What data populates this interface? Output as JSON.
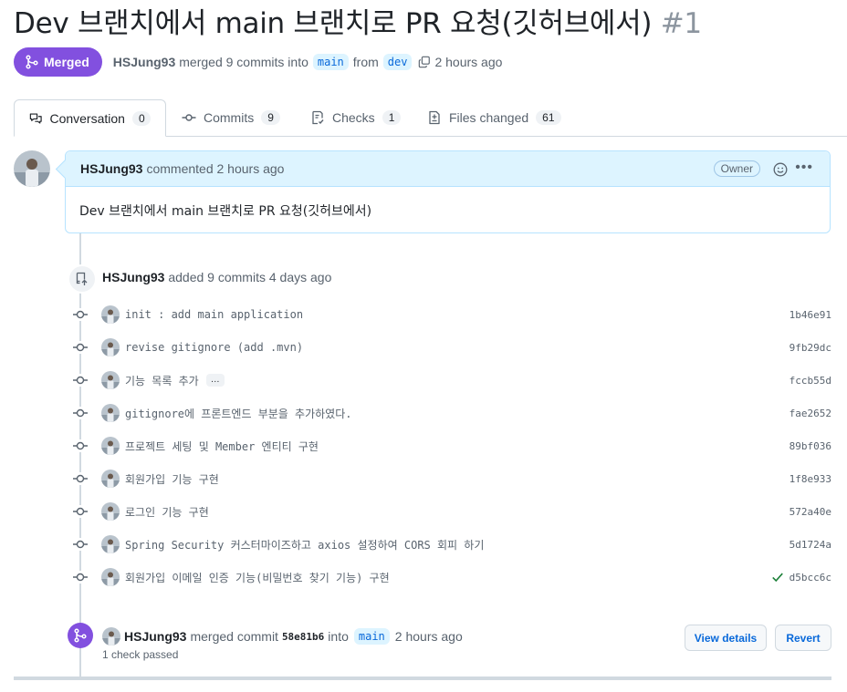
{
  "pr": {
    "title": "Dev 브랜치에서 main 브랜치로 PR 요청(깃허브에서)",
    "number": "#1",
    "state": "Merged",
    "author": "HSJung93",
    "merged_text": "merged 9 commits into",
    "base_branch": "main",
    "from_text": "from",
    "head_branch": "dev",
    "time": "2 hours ago"
  },
  "tabs": [
    {
      "label": "Conversation",
      "count": "0",
      "icon": "comment-discussion-icon"
    },
    {
      "label": "Commits",
      "count": "9",
      "icon": "git-commit-icon"
    },
    {
      "label": "Checks",
      "count": "1",
      "icon": "checklist-icon"
    },
    {
      "label": "Files changed",
      "count": "61",
      "icon": "file-diff-icon"
    }
  ],
  "comment": {
    "author": "HSJung93",
    "action": "commented 2 hours ago",
    "badge": "Owner",
    "body": "Dev 브랜치에서 main 브랜치로 PR 요청(깃허브에서)"
  },
  "commits_event": {
    "author": "HSJung93",
    "text": "added 9 commits 4 days ago"
  },
  "commits": [
    {
      "message": "init : add main application",
      "sha": "1b46e91"
    },
    {
      "message": "revise gitignore (add .mvn)",
      "sha": "9fb29dc"
    },
    {
      "message": "기능 목록 추가",
      "sha": "fccb55d",
      "ellipsis": "…"
    },
    {
      "message": "gitignore에 프론트엔드 부분을 추가하였다.",
      "sha": "fae2652"
    },
    {
      "message": "프로젝트 세팅 및 Member 엔티티 구현",
      "sha": "89bf036"
    },
    {
      "message": "회원가입 기능 구현",
      "sha": "1f8e933"
    },
    {
      "message": "로그인 기능 구현",
      "sha": "572a40e"
    },
    {
      "message": "Spring Security 커스터마이즈하고 axios 설정하여 CORS 회피 하기",
      "sha": "5d1724a"
    },
    {
      "message": "회원가입 이메일 인증 기능(비밀번호 찾기 기능) 구현",
      "sha": "d5bcc6c",
      "verified": true
    }
  ],
  "merge_event": {
    "author": "HSJung93",
    "text": "merged commit",
    "sha": "58e81b6",
    "into": "into",
    "branch": "main",
    "time": "2 hours ago",
    "checks": "1 check passed",
    "view_label": "View details",
    "revert_label": "Revert"
  },
  "colors": {
    "merged": "#8250df",
    "link": "#0969da",
    "comment_header": "#ddf4ff",
    "success": "#1a7f37"
  }
}
